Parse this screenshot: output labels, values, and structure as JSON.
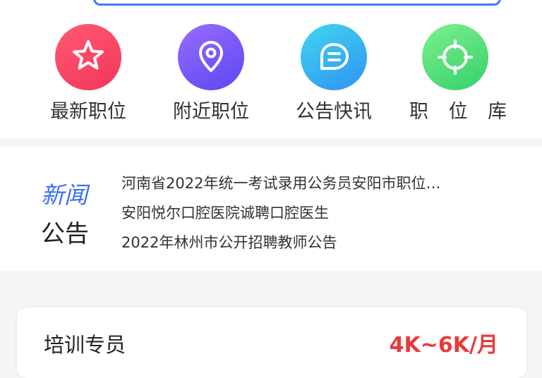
{
  "quick_nav": [
    {
      "label": "最新职位",
      "icon": "star-icon",
      "color": "#f2365a"
    },
    {
      "label": "附近职位",
      "icon": "location-pin-icon",
      "color": "#6a4ff3"
    },
    {
      "label": "公告快讯",
      "icon": "chat-bubble-icon",
      "color": "#2fa8f1"
    },
    {
      "label": "职 位 库",
      "icon": "target-icon",
      "color": "#3fd46f"
    }
  ],
  "news": {
    "badge_top": "新闻",
    "badge_bottom": "公告",
    "items": [
      "河南省2022年统一考试录用公务员安阳市职位…",
      "安阳悦尔口腔医院诚聘口腔医生",
      "2022年林州市公开招聘教师公告"
    ]
  },
  "job": {
    "title": "培训专员",
    "salary": "4K~6K/月"
  },
  "colors": {
    "accent": "#3d7bf7",
    "salary": "#e83a3a",
    "news_badge": "#3d6ef0"
  }
}
